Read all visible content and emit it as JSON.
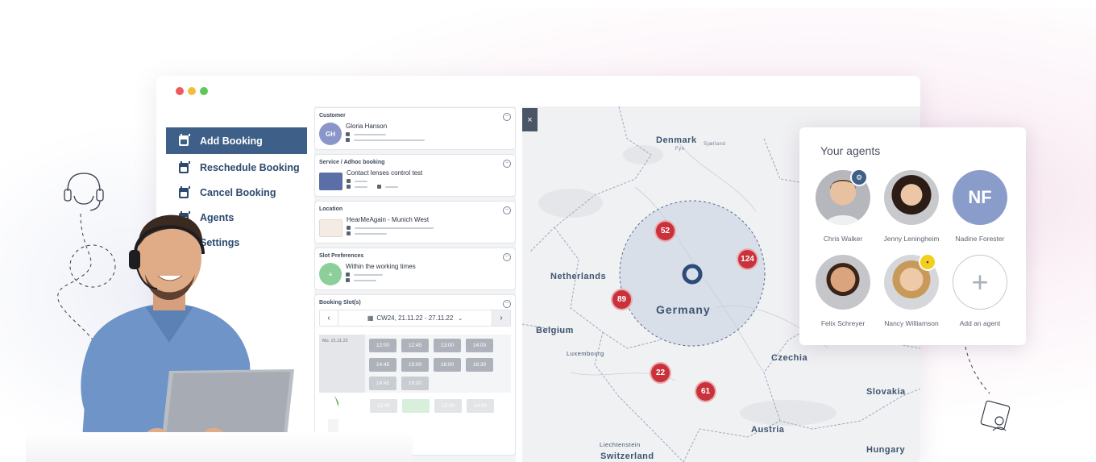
{
  "window": {
    "dots": [
      "#ee5a5a",
      "#f2bd3c",
      "#5ec75b"
    ]
  },
  "sidebar": {
    "items": [
      {
        "label": "Add Booking",
        "icon": "calendar-plus-icon",
        "active": true
      },
      {
        "label": "Reschedule Booking",
        "icon": "calendar-edit-icon"
      },
      {
        "label": "Cancel Booking",
        "icon": "calendar-cancel-icon"
      },
      {
        "label": "Agents",
        "icon": "agents-icon"
      },
      {
        "label": "Settings",
        "icon": "settings-icon"
      }
    ]
  },
  "form": {
    "customer": {
      "title": "Customer",
      "initials": "GH",
      "name": "Gloria Hanson"
    },
    "service": {
      "title": "Service / Adhoc booking",
      "name": "Contact lenses control test"
    },
    "location": {
      "title": "Location",
      "name": "HearMeAgain - Munich West"
    },
    "slot_prefs": {
      "title": "Slot Preferences",
      "value": "Within the working times"
    },
    "booking_slots": {
      "title": "Booking Slot(s)",
      "week": "CW24, 21.11.22 - 27.11.22",
      "day": "Mo. 21.11.22",
      "slots": [
        "12:00",
        "12:45",
        "13:00",
        "14:00",
        "14:45",
        "15:00",
        "16:00",
        "16:30",
        "18:45",
        "19:00"
      ],
      "faded_slots": [
        "13:00",
        "",
        "13:00",
        "14:00"
      ]
    }
  },
  "map": {
    "close": "×",
    "labels": {
      "denmark": "Denmark",
      "fyn": "Fyn",
      "sjaelland": "Sjælland",
      "netherlands": "Netherlands",
      "belgium": "Belgium",
      "luxembourg": "Luxembourg",
      "germany": "Germany",
      "czechia": "Czechia",
      "slovakia": "Slovakia",
      "austria": "Austria",
      "liechtenstein": "Liechtenstein",
      "switzerland": "Switzerland",
      "hungary": "Hungary"
    },
    "pins": {
      "p52": "52",
      "p124": "124",
      "p89": "89",
      "p22": "22",
      "p61": "61"
    }
  },
  "agents": {
    "title": "Your agents",
    "list": [
      {
        "name": "Chris Walker",
        "badge": "gears-icon"
      },
      {
        "name": "Jenny Leningheim"
      },
      {
        "name": "Nadine Forester",
        "initials": "NF"
      },
      {
        "name": "Felix Schreyer"
      },
      {
        "name": "Nancy Williamson",
        "badge": "briefcase-icon"
      },
      {
        "name": "Add an agent",
        "icon": "plus-icon"
      }
    ]
  },
  "colors": {
    "accent": "#3d5f88",
    "pin": "#c9323b",
    "badge_blue": "#3d5f88",
    "badge_yellow": "#f2cf1d"
  }
}
